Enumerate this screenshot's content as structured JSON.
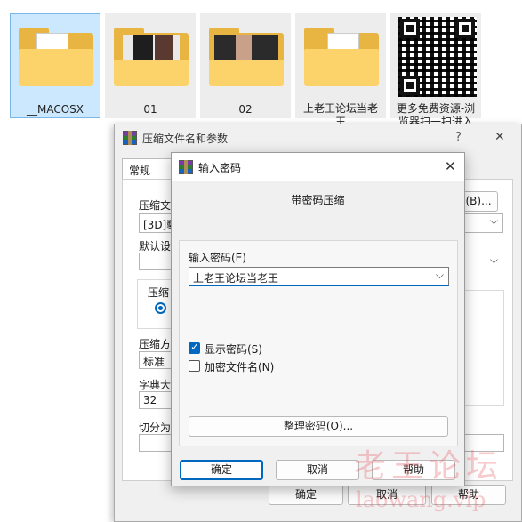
{
  "files": [
    {
      "name": "__MACOSX",
      "type": "folder",
      "selected": true
    },
    {
      "name": "01",
      "type": "folder-preview"
    },
    {
      "name": "02",
      "type": "folder-preview"
    },
    {
      "name": "上老王论坛当老王",
      "type": "folder"
    },
    {
      "name": "更多免费资源-浏览器扫一扫进入",
      "type": "qr-image"
    }
  ],
  "archive_dialog": {
    "title": "压缩文件名和参数",
    "help_icon": "?",
    "close_icon": "✕",
    "tab_general": "常规",
    "archive_name_label": "压缩文",
    "archive_name_value": "[3D]鑿",
    "browse_button": "(B)...",
    "default_profile_label": "默认设",
    "format_label": "压缩",
    "method_label": "压缩方",
    "method_value": "标准",
    "dict_label": "字典大",
    "dict_value": "32",
    "split_label": "切分为",
    "ok_button": "确定",
    "cancel_button": "取消",
    "help_button": "帮助"
  },
  "password_dialog": {
    "title": "输入密码",
    "close_icon": "✕",
    "subtitle": "带密码压缩",
    "password_label": "输入密码(E)",
    "password_value": "上老王论坛当老王",
    "show_password_label": "显示密码(S)",
    "show_password_checked": true,
    "encrypt_names_label": "加密文件名(N)",
    "encrypt_names_checked": false,
    "organize_button": "整理密码(O)...",
    "ok_button": "确定",
    "cancel_button": "取消",
    "help_button": "帮助"
  },
  "watermark": {
    "line1": "老王论坛",
    "line2": "laowang.vip"
  },
  "colors": {
    "selection": "#cce8ff",
    "accent": "#0067c0",
    "folder": "#fcd36a"
  }
}
